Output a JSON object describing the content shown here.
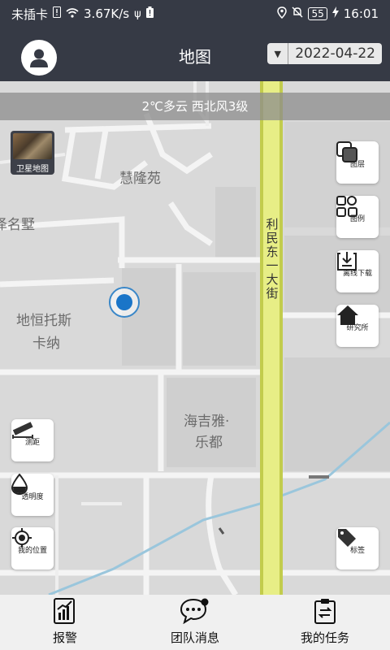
{
  "status_bar": {
    "carrier": "未插卡",
    "speed": "3.67K/s",
    "battery": "55",
    "time": "16:01"
  },
  "header": {
    "title": "地图",
    "date": "2022-04-22"
  },
  "weather": "2℃多云   西北风3级",
  "map_labels": {
    "huilongyuan": "慧隆苑",
    "mingshu": "泽名墅",
    "dihengtuosi": "地恒托斯",
    "kana": "卡纳",
    "haijiya": "海吉雅·",
    "ledu": "乐都",
    "road": "利民东一大街"
  },
  "satellite": {
    "label": "卫星地图"
  },
  "tools": {
    "layers": "图层",
    "legend": "图例",
    "offline": "离线下载",
    "institute": "研究所",
    "measure": "测距",
    "opacity": "透明度",
    "my_location": "我的位置",
    "tags": "标签"
  },
  "nav": {
    "alarm": "报警",
    "team_msg": "团队消息",
    "my_tasks": "我的任务"
  }
}
